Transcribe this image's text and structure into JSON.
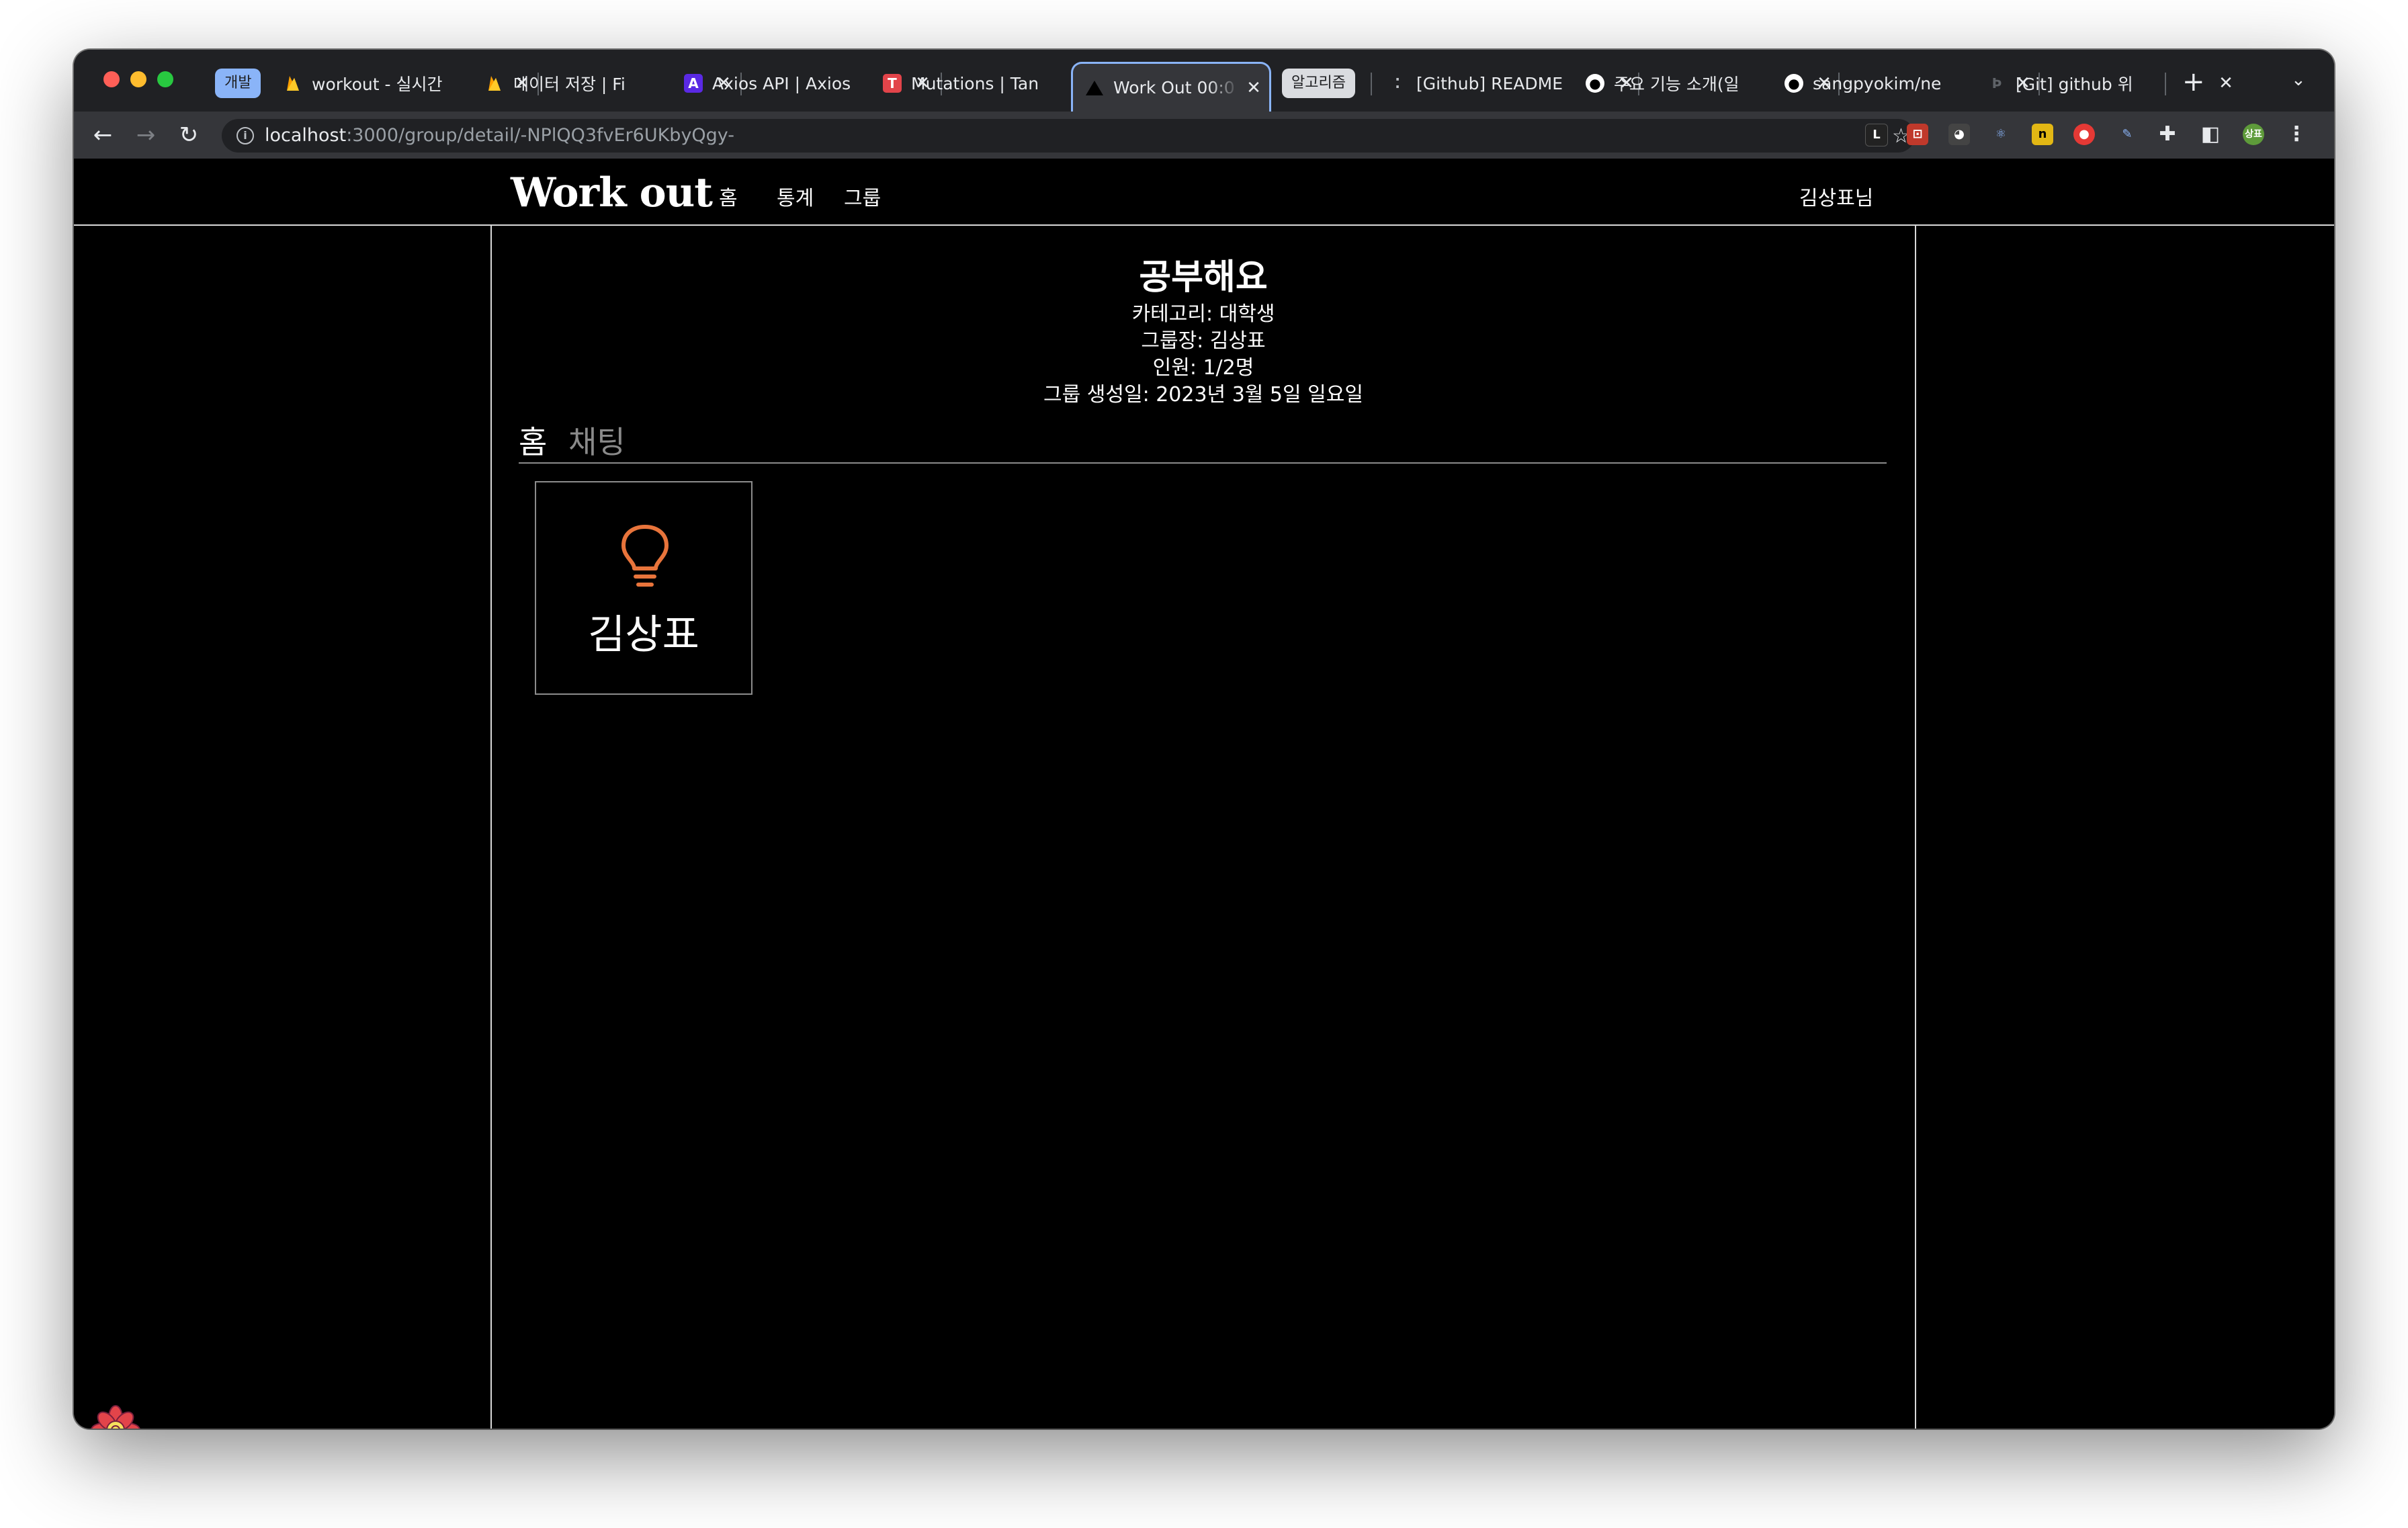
{
  "browser": {
    "tab_groups": [
      {
        "label": "개발",
        "color": "#8ab4f8"
      },
      {
        "label": "알고리즘",
        "color": "#dadce0"
      }
    ],
    "tabs": [
      {
        "title": "workout - 실시간",
        "favicon": "firebase-icon",
        "active": false
      },
      {
        "title": "데이터 저장 | Fi",
        "favicon": "firebase-icon",
        "active": false
      },
      {
        "title": "Axios API | Axios",
        "favicon": "axios-icon",
        "active": false
      },
      {
        "title": "Mutations | Tan",
        "favicon": "tanstack-icon",
        "active": false
      },
      {
        "title": "Work Out 00:0",
        "favicon": "vercel-icon",
        "active": true
      },
      {
        "title": "[Github] README",
        "favicon": "dots-icon",
        "active": false
      },
      {
        "title": "주요 기능 소개(일",
        "favicon": "github-icon",
        "active": false
      },
      {
        "title": "sangpyokim/ne",
        "favicon": "github-icon",
        "active": false
      },
      {
        "title": "[Git] github 위",
        "favicon": "page-icon",
        "active": false
      }
    ],
    "url": {
      "host": "localhost",
      "path": ":3000/group/detail/-NPlQQ3fvEr6UKbyQgy-"
    },
    "profile_initials": "상표"
  },
  "app": {
    "logo": "Work out",
    "nav": [
      "홈",
      "통계",
      "그룹"
    ],
    "user": "김상표님"
  },
  "group": {
    "title": "공부해요",
    "category": "카테고리: 대학생",
    "leader": "그룹장: 김상표",
    "members_count": "인원: 1/2명",
    "created": "그룹 생성일: 2023년 3월 5일 일요일"
  },
  "page_tabs": [
    {
      "label": "홈",
      "active": true
    },
    {
      "label": "채팅",
      "active": false
    }
  ],
  "members": [
    {
      "name": "김상표",
      "icon": "lightbulb-icon",
      "icon_color": "#e8743b"
    }
  ]
}
